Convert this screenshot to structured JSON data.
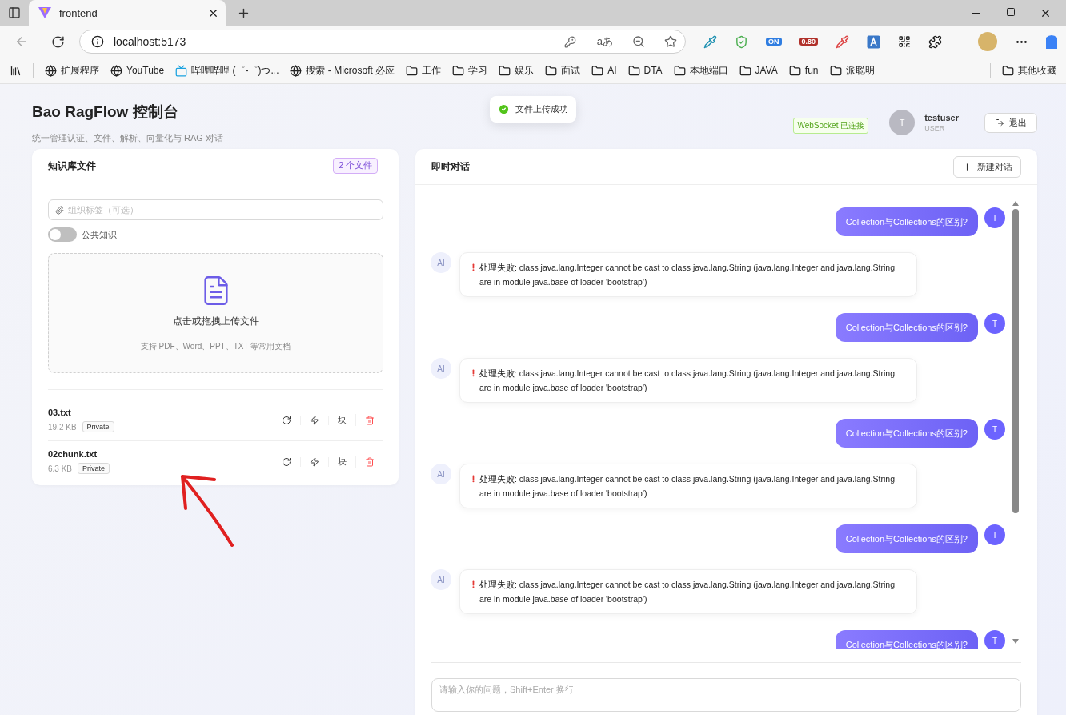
{
  "browser": {
    "tabs": [
      {
        "title": "frontend",
        "selected": true
      }
    ],
    "url": "localhost:5173",
    "read_aloud_glyph": "aあ",
    "extension_badges": [
      "ON",
      "0.80"
    ],
    "bookmarks": [
      {
        "kind": "globe",
        "label": "扩展程序"
      },
      {
        "kind": "globe",
        "label": "YouTube"
      },
      {
        "kind": "tv",
        "label": "哔哩哔哩 (゜-゜)つ..."
      },
      {
        "kind": "globe",
        "label": "搜索 - Microsoft 必应"
      },
      {
        "kind": "folder",
        "label": "工作"
      },
      {
        "kind": "folder",
        "label": "学习"
      },
      {
        "kind": "folder",
        "label": "娱乐"
      },
      {
        "kind": "folder",
        "label": "面试"
      },
      {
        "kind": "folder",
        "label": "AI"
      },
      {
        "kind": "folder",
        "label": "DTA"
      },
      {
        "kind": "folder",
        "label": "本地端口"
      },
      {
        "kind": "folder",
        "label": "JAVA"
      },
      {
        "kind": "folder",
        "label": "fun"
      },
      {
        "kind": "folder",
        "label": "派聪明"
      }
    ],
    "other_bookmarks": "其他收藏"
  },
  "header": {
    "title": "Bao RagFlow 控制台",
    "subtitle": "统一管理认证、文件、解析、向量化与 RAG 对话",
    "connection": "WebSocket 已连接",
    "user": {
      "avatar": "T",
      "name": "testuser",
      "role": "USER"
    },
    "logout": "退出"
  },
  "toast": "文件上传成功",
  "knowledge": {
    "title": "知识库文件",
    "count": "2 个文件",
    "tag_field": {
      "placeholder": "组织标签（可选）"
    },
    "public_toggle": {
      "label": "公共知识",
      "on": false
    },
    "upload": {
      "title": "点击或拖拽上传文件",
      "hint": "支持 PDF、Word、PPT、TXT 等常用文档"
    },
    "files": [
      {
        "name": "03.txt",
        "size": "19.2 KB",
        "visibility": "Private",
        "chunk_action": "块"
      },
      {
        "name": "02chunk.txt",
        "size": "6.3 KB",
        "visibility": "Private",
        "chunk_action": "块"
      }
    ]
  },
  "chat": {
    "title": "即时对话",
    "new_chat": "新建对话",
    "messages": [
      {
        "kind": "user",
        "avatar": "T",
        "text": "Collection与Collections的区别?"
      },
      {
        "kind": "ai",
        "avatar": "AI",
        "text": "处理失败: class java.lang.Integer cannot be cast to class java.lang.String (java.lang.Integer and java.lang.String are in module java.base of loader 'bootstrap')"
      },
      {
        "kind": "user",
        "avatar": "T",
        "text": "Collection与Collections的区别?"
      },
      {
        "kind": "ai",
        "avatar": "AI",
        "text": "处理失败: class java.lang.Integer cannot be cast to class java.lang.String (java.lang.Integer and java.lang.String are in module java.base of loader 'bootstrap')"
      },
      {
        "kind": "user",
        "avatar": "T",
        "text": "Collection与Collections的区别?"
      },
      {
        "kind": "ai",
        "avatar": "AI",
        "text": "处理失败: class java.lang.Integer cannot be cast to class java.lang.String (java.lang.Integer and java.lang.String are in module java.base of loader 'bootstrap')"
      },
      {
        "kind": "user",
        "avatar": "T",
        "text": "Collection与Collections的区别?"
      },
      {
        "kind": "ai",
        "avatar": "AI",
        "text": "处理失败: class java.lang.Integer cannot be cast to class java.lang.String (java.lang.Integer and java.lang.String are in module java.base of loader 'bootstrap')"
      },
      {
        "kind": "user",
        "avatar": "T",
        "text": "Collection与Collections的区别?"
      }
    ],
    "input": {
      "placeholder": "请输入你的问题，Shift+Enter 换行"
    }
  }
}
